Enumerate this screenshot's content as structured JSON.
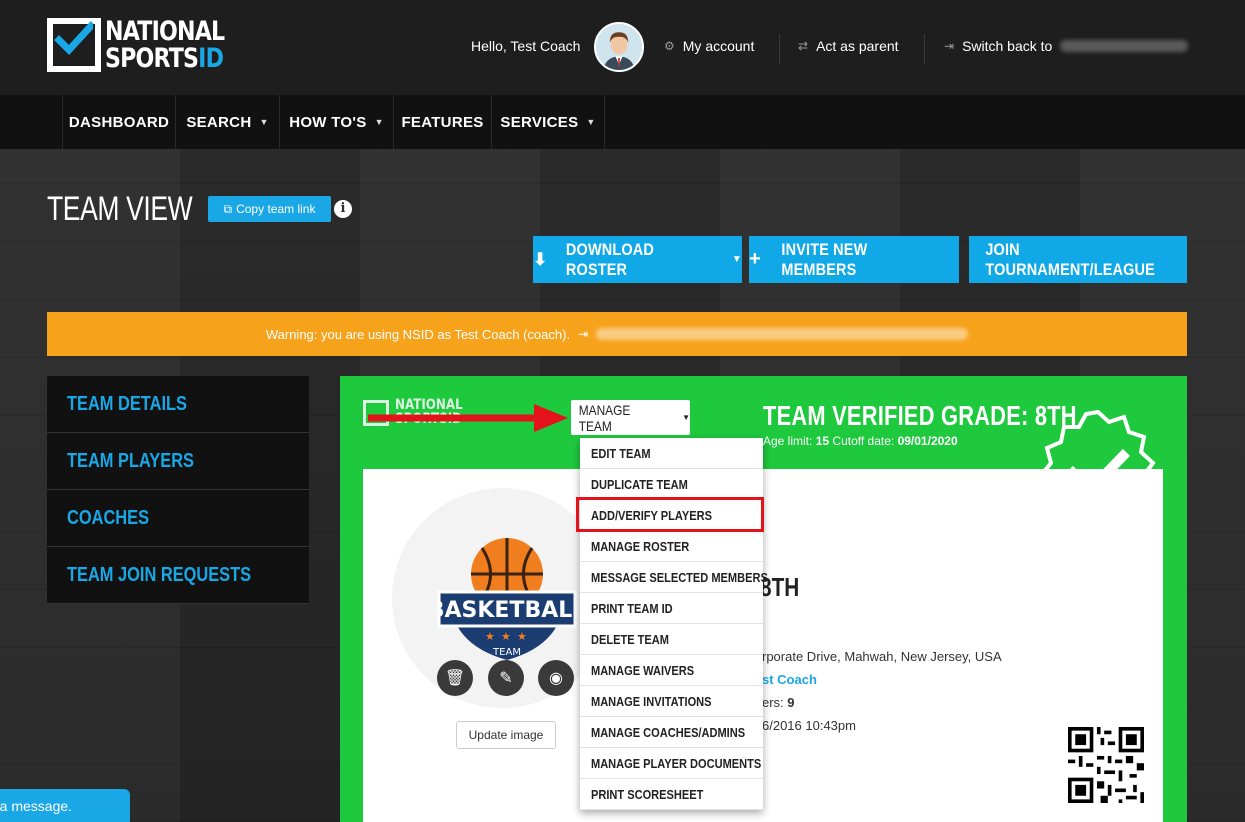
{
  "header": {
    "logo_line1": "NATIONAL",
    "logo_line2_a": "SPORTS",
    "logo_line2_b": "ID",
    "greeting": "Hello, Test Coach",
    "my_account": "My account",
    "act_as_parent": "Act as parent",
    "switch_back": "Switch back to"
  },
  "nav": {
    "items": [
      {
        "label": "DASHBOARD"
      },
      {
        "label": "SEARCH"
      },
      {
        "label": "HOW TO'S"
      },
      {
        "label": "FEATURES"
      },
      {
        "label": "SERVICES"
      }
    ]
  },
  "page": {
    "title": "TEAM VIEW",
    "copy_link": "Copy team link",
    "info_glyph": "i"
  },
  "actions": {
    "download_roster": "DOWNLOAD ROSTER",
    "invite_members": "INVITE NEW MEMBERS",
    "join_tournament": "JOIN TOURNAMENT/LEAGUE"
  },
  "warning": {
    "text": "Warning: you are using NSID as Test Coach (coach)."
  },
  "sidebar": {
    "items": [
      {
        "label": "TEAM DETAILS"
      },
      {
        "label": "TEAM PLAYERS"
      },
      {
        "label": "COACHES"
      },
      {
        "label": "TEAM JOIN REQUESTS"
      }
    ]
  },
  "card": {
    "logo_line1": "NATIONAL",
    "logo_line2": "SPORTSID",
    "manage_team": "MANAGE TEAM",
    "team_grade": "TEAM VERIFIED GRADE: 8TH",
    "age_limit_label": "Age limit:",
    "age_limit": "15",
    "cutoff_label": "Cutoff date:",
    "cutoff": "09/01/2020",
    "update_image": "Update image",
    "basketball_word": "BASKETBALL",
    "basketball_team": "TEAM",
    "partial_grade": "8TH",
    "partial_address": "rporate Drive, Mahwah, New Jersey, USA",
    "partial_coach": "st Coach",
    "partial_members_label": "ers:",
    "partial_members": "9",
    "partial_date": "6/2016 10:43pm"
  },
  "manage_menu": {
    "items": [
      {
        "label": "EDIT TEAM"
      },
      {
        "label": "DUPLICATE TEAM"
      },
      {
        "label": "ADD/VERIFY PLAYERS"
      },
      {
        "label": "MANAGE ROSTER"
      },
      {
        "label": "MESSAGE SELECTED MEMBERS"
      },
      {
        "label": "PRINT TEAM ID"
      },
      {
        "label": "DELETE TEAM"
      },
      {
        "label": "MANAGE WAIVERS"
      },
      {
        "label": "MANAGE INVITATIONS"
      },
      {
        "label": "MANAGE COACHES/ADMINS"
      },
      {
        "label": "MANAGE PLAYER DOCUMENTS"
      },
      {
        "label": "PRINT SCORESHEET"
      }
    ],
    "highlighted": "ADD/VERIFY PLAYERS"
  },
  "chat": {
    "label": "e a message."
  },
  "colors": {
    "accent_blue": "#1aa7e6",
    "card_green": "#1ec93e",
    "warning_orange": "#f7a21b",
    "highlight_red": "#e4121b"
  }
}
